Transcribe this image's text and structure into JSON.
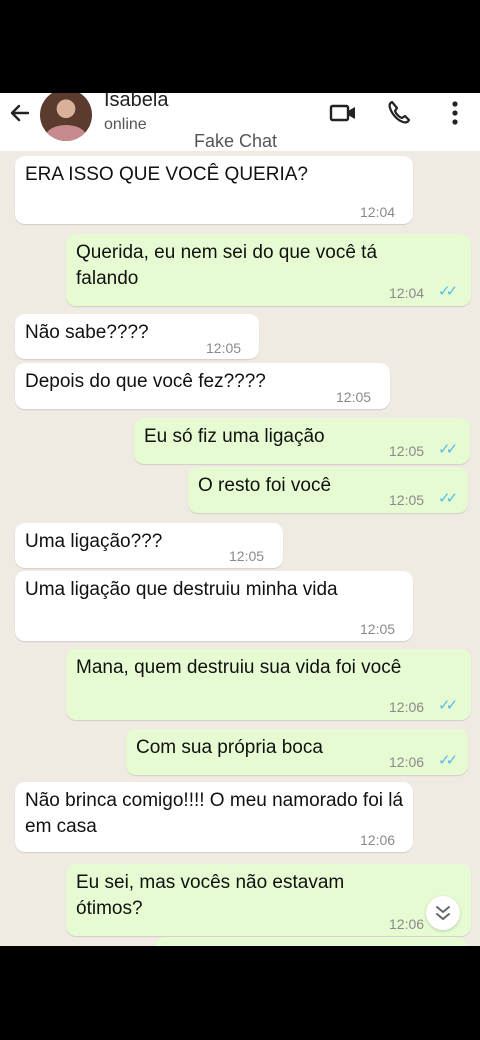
{
  "contact": {
    "name": "Isabela",
    "status": "online"
  },
  "caption": "Fake Chat",
  "icons": {
    "back": "arrow-left-icon",
    "video": "video-call-icon",
    "call": "phone-icon",
    "menu": "more-vert-icon",
    "scroll": "chevron-down-icon"
  },
  "colors": {
    "incoming": "#ffffff",
    "outgoing": "#e7fbd3",
    "read_ticks": "#53bdeb",
    "background": "#efeae2"
  },
  "messages": [
    {
      "dir": "in",
      "text": "ERA ISSO QUE VOCÊ QUERIA?",
      "time": "12:04"
    },
    {
      "dir": "out",
      "text": "Querida, eu nem sei do que você tá falando",
      "time": "12:04",
      "ticks": "✓✓"
    },
    {
      "dir": "in",
      "text": "Não sabe????",
      "time": "12:05"
    },
    {
      "dir": "in",
      "text": "Depois do que você fez????",
      "time": "12:05"
    },
    {
      "dir": "out",
      "text": "Eu só fiz uma ligação",
      "time": "12:05",
      "ticks": "✓✓"
    },
    {
      "dir": "out",
      "text": "O resto foi você",
      "time": "12:05",
      "ticks": "✓✓"
    },
    {
      "dir": "in",
      "text": "Uma ligação???",
      "time": "12:05"
    },
    {
      "dir": "in",
      "text": "Uma ligação que destruiu minha vida",
      "time": "12:05"
    },
    {
      "dir": "out",
      "text": "Mana, quem destruiu sua vida foi você",
      "time": "12:06",
      "ticks": "✓✓"
    },
    {
      "dir": "out",
      "text": "Com sua própria boca",
      "time": "12:06",
      "ticks": "✓✓"
    },
    {
      "dir": "in",
      "text": "Não brinca comigo!!!! O meu namorado foi lá em casa",
      "time": "12:06"
    },
    {
      "dir": "out",
      "text": "Eu sei, mas vocês não estavam ótimos?",
      "time": "12:06"
    }
  ]
}
